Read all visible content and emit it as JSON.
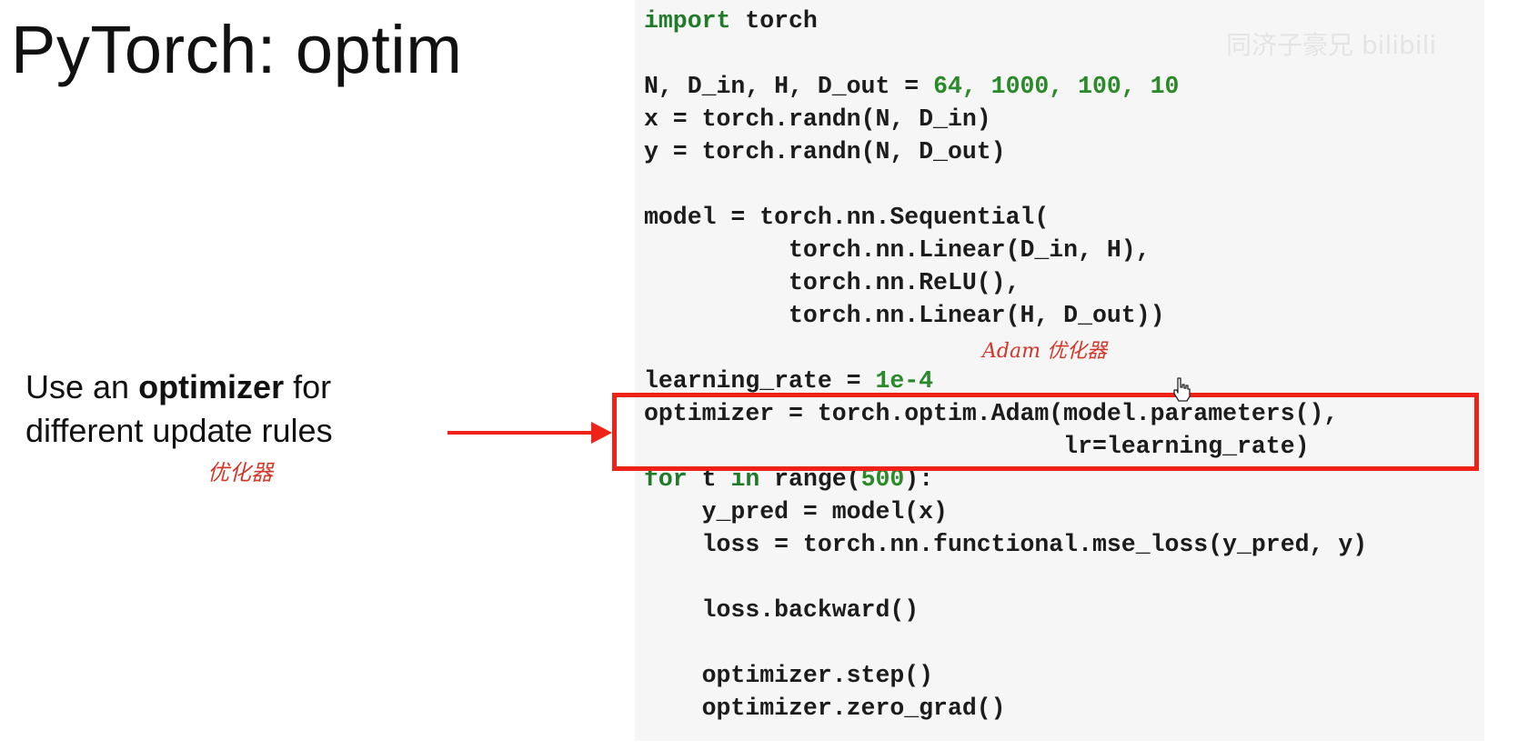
{
  "slide": {
    "title": "PyTorch: optim",
    "caption_line1_pre": "Use an ",
    "caption_line1_bold": "optimizer",
    "caption_line1_post": " for",
    "caption_line2": "different update rules"
  },
  "annotations": {
    "note_left": "优化器",
    "note_top": "Adam 优化器"
  },
  "watermark": {
    "text": "同济子豪兄 bilibili"
  },
  "colors": {
    "accent_red": "#ee2216",
    "keyword_green": "#1f7a2a",
    "handwriting_red": "#d2382a"
  },
  "icons": {
    "cursor": "hand-pointer-icon",
    "arrow": "right-arrow-icon"
  },
  "code": {
    "lines": [
      {
        "kw": "import",
        "rest": " torch"
      },
      {
        "text": ""
      },
      {
        "pre": "N, D_in, H, D_out = ",
        "nums": "64, 1000, 100, 10"
      },
      {
        "text": "x = torch.randn(N, D_in)"
      },
      {
        "text": "y = torch.randn(N, D_out)"
      },
      {
        "text": ""
      },
      {
        "text": "model = torch.nn.Sequential("
      },
      {
        "text": "          torch.nn.Linear(D_in, H),"
      },
      {
        "text": "          torch.nn.ReLU(),"
      },
      {
        "text": "          torch.nn.Linear(H, D_out))"
      },
      {
        "text": ""
      },
      {
        "pre": "learning_rate = ",
        "nums": "1e-4"
      },
      {
        "text": "optimizer = torch.optim.Adam(model.parameters(),"
      },
      {
        "text": "                             lr=learning_rate)"
      },
      {
        "kw": "for",
        "rest": " t ",
        "kw2": "in",
        "rest2": " range(",
        "num2": "500",
        "rest3": "):"
      },
      {
        "text": "    y_pred = model(x)"
      },
      {
        "text": "    loss = torch.nn.functional.mse_loss(y_pred, y)"
      },
      {
        "text": ""
      },
      {
        "text": "    loss.backward()"
      },
      {
        "text": ""
      },
      {
        "text": "    optimizer.step()"
      },
      {
        "text": "    optimizer.zero_grad()"
      }
    ]
  }
}
